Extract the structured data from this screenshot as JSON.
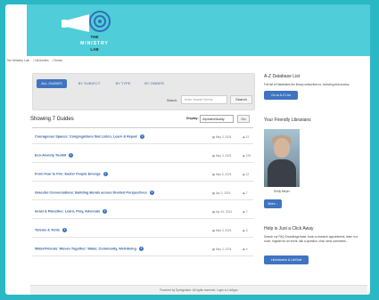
{
  "brand": {
    "line1": "THE",
    "line2": "MINISTRY",
    "line3": "LAB",
    "accent": "#4fcdd8",
    "button_color": "#3e74c0"
  },
  "breadcrumb": {
    "items": [
      "The Ministry Lab",
      "LibGuides",
      "Home"
    ]
  },
  "tabs": [
    {
      "label": "ALL GUIDES"
    },
    {
      "label": "BY SUBJECT"
    },
    {
      "label": "BY TYPE"
    },
    {
      "label": "BY OWNER"
    }
  ],
  "search": {
    "label": "Search:",
    "placeholder": "Enter Search Words",
    "button": "Search"
  },
  "guides_header": {
    "showing": "Showing 7 Guides",
    "display_label": "Display:",
    "display_value": "Alphabetically",
    "go": "Go"
  },
  "guides": [
    {
      "title": "Courageous Spaces: Congregations that Listen, Learn & Repair",
      "date": "May 3, 2024",
      "views": "12"
    },
    {
      "title": "Eco-Anxiety Toolkit",
      "date": "May 3, 2024",
      "views": "125"
    },
    {
      "title": "From Fear to Fire: Easter People Emerge",
      "date": "May 5, 2024",
      "views": "12"
    },
    {
      "title": "Graceful Conversations: Building Bonds across Divided Perspectives",
      "date": "Apr 3, 2024",
      "views": "7"
    },
    {
      "title": "Israel & Palestine: Learn, Pray, Advocate",
      "date": "Apr 10, 2024",
      "views": "7"
    },
    {
      "title": "Totems & Tents",
      "date": "May 3, 2024",
      "views": "5"
    },
    {
      "title": "Water/Friends: Woven Together: Water, Community, Well-Being",
      "date": "May 3, 2024",
      "views": "4"
    }
  ],
  "sidebar": {
    "az": {
      "title": "A-Z Database List",
      "text": "Full list of Databases the library subscribes to, including trial access.",
      "button": "Go to A-Z List"
    },
    "librarians": {
      "title": "Your Friendly Librarians",
      "name": "Emily Meyer",
      "button": "More..."
    },
    "help": {
      "title": "Help is Just a Click Away",
      "text": "Search our FAQ Knowledge base, book a research appointment, learn in a room, register for an event, ask a question, chat, send comments...",
      "button": "LibAnswers & LibChat"
    }
  },
  "footer": {
    "text": "Powered by Springshare.  All rights reserved.  Login to LibApps"
  }
}
